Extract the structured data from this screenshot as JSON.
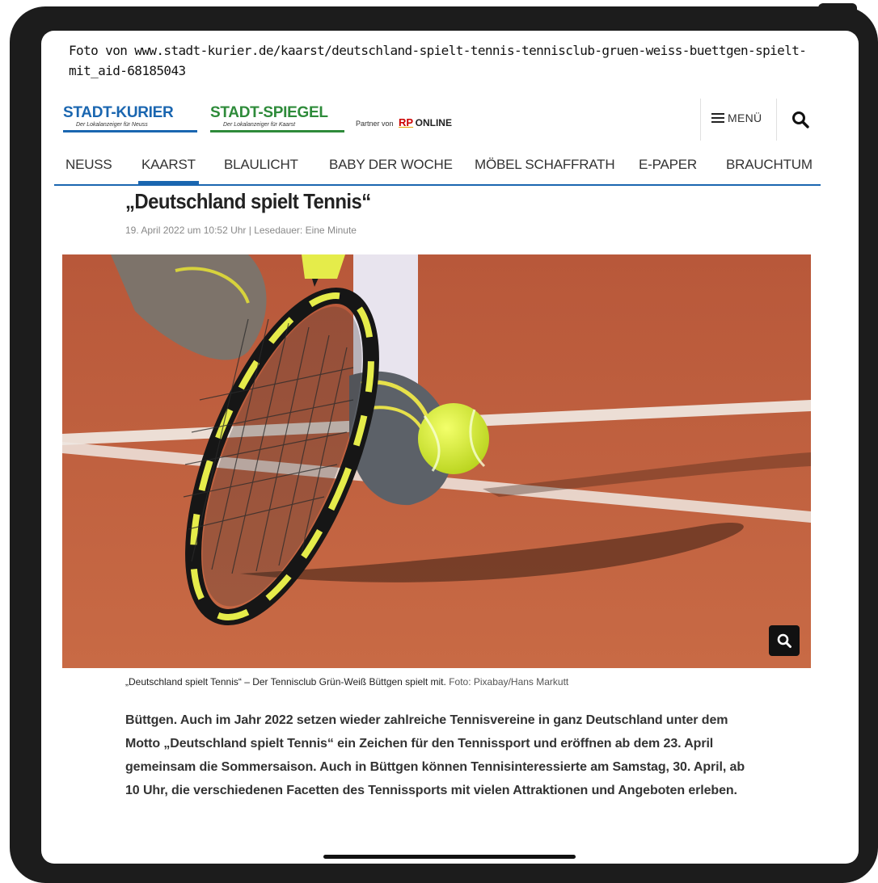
{
  "source_note": "Foto von www.stadt-kurier.de/kaarst/deutschland-spielt-tennis-tennisclub-gruen-weiss-buettgen-spielt-mit_aid-68185043",
  "header": {
    "logo_kurier": "STADT-KURIER",
    "logo_kurier_sub": "Der Lokalanzeiger für Neuss",
    "logo_spiegel": "STADT-SPIEGEL",
    "logo_spiegel_sub": "Der Lokalanzeiger für Kaarst",
    "partner_prefix": "Partner von",
    "partner_rp": "RP",
    "partner_online": "ONLINE",
    "menu_label": "MENÜ"
  },
  "nav": {
    "items": [
      "NEUSS",
      "KAARST",
      "BLAULICHT",
      "BABY DER WOCHE",
      "MÖBEL SCHAFFRATH",
      "E-PAPER",
      "BRAUCHTUM"
    ],
    "active": "KAARST"
  },
  "article": {
    "headline": "„Deutschland spielt Tennis“",
    "meta": "19. April 2022 um 10:52 Uhr | Lesedauer: Eine Minute",
    "caption": "„Deutschland spielt Tennis“ – Der Tennisclub Grün-Weiß Büttgen spielt mit.",
    "caption_credit": "Foto: Pixabay/Hans Markutt",
    "body": "Büttgen. Auch im Jahr 2022 setzen wieder zahlreiche Tennisvereine in ganz Deutschland unter dem Motto „Deutschland spielt Tennis“ ein Zeichen für den Tennissport und eröffnen ab dem 23. April gemeinsam die Sommersaison. Auch in Büttgen können Tennisinteressierte am Samstag, 30. April, ab 10 Uhr, die verschiedenen Facetten des Tennissports mit vielen Attraktionen und Angeboten erleben."
  },
  "colors": {
    "brand_blue": "#1a66b0",
    "brand_green": "#2e8b3a",
    "clay": "#c4603a"
  },
  "icons": {
    "menu": "hamburger-icon",
    "search": "search-icon",
    "zoom": "zoom-icon"
  }
}
